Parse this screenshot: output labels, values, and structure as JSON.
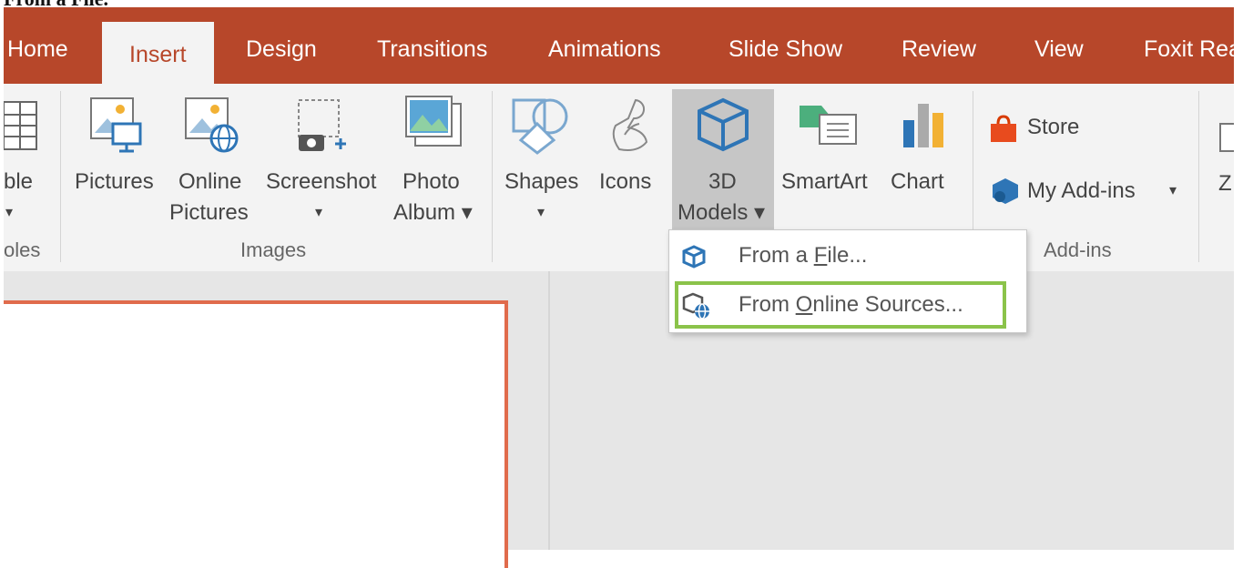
{
  "caption": "From a File.",
  "tabs": [
    "Home",
    "Insert",
    "Design",
    "Transitions",
    "Animations",
    "Slide Show",
    "Review",
    "View",
    "Foxit Rea"
  ],
  "active_tab": "Insert",
  "groups": {
    "tables_partial": {
      "btn_line1": "ble",
      "btn_arrow": "▾",
      "label": "oles"
    },
    "images": {
      "label": "Images",
      "pictures": "Pictures",
      "online_pictures": [
        "Online",
        "Pictures"
      ],
      "screenshot": "Screenshot",
      "screenshot_arrow": "▾",
      "photo_album": [
        "Photo",
        "Album ▾"
      ]
    },
    "illustrations": {
      "shapes": "Shapes",
      "shapes_arrow": "▾",
      "icons": "Icons",
      "models_3d": [
        "3D",
        "Models ▾"
      ],
      "smartart": "SmartArt",
      "chart": "Chart"
    },
    "addins": {
      "label": "Add-ins",
      "store": "Store",
      "my_addins": "My Add-ins",
      "my_addins_arrow": "▾"
    },
    "zoom_partial": "Z"
  },
  "dropdown": {
    "from_file": {
      "pre": "From a ",
      "accel": "F",
      "post": "ile..."
    },
    "from_online": {
      "pre": "From ",
      "accel": "O",
      "post": "nline Sources..."
    }
  },
  "colors": {
    "accent": "#b7472a",
    "highlight": "#8bc34a",
    "slide_border": "#e06b4c"
  }
}
